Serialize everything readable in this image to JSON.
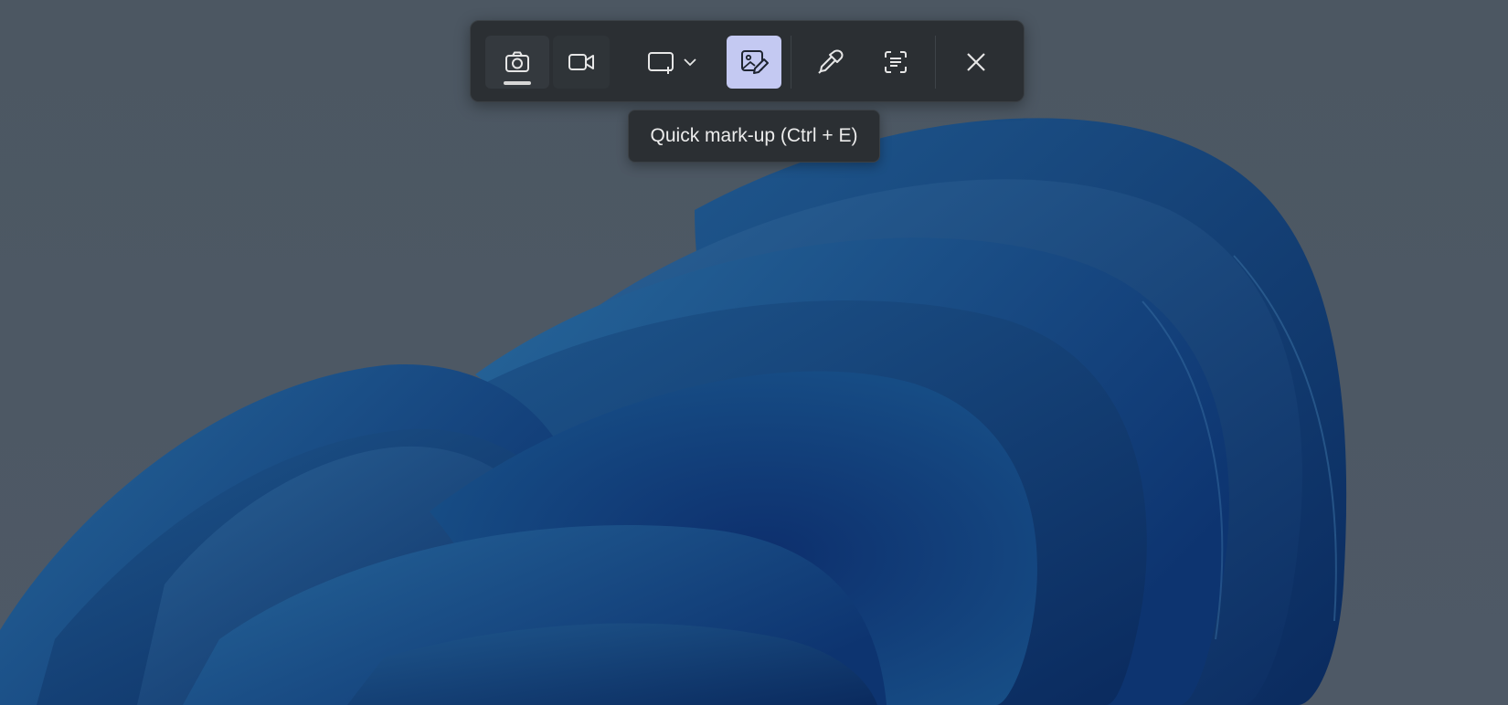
{
  "snipping_toolbar": {
    "buttons": [
      {
        "name": "snip-photo-mode",
        "icon": "camera-icon",
        "active": true
      },
      {
        "name": "snip-video-mode",
        "icon": "video-camera-icon",
        "active": false
      },
      {
        "name": "snip-area-mode-dropdown",
        "icon": "rectangle-area-icon",
        "dropdown_icon": "chevron-down-icon"
      },
      {
        "name": "quick-markup",
        "icon": "image-pen-icon",
        "highlighted": true
      },
      {
        "name": "color-picker",
        "icon": "eyedropper-icon"
      },
      {
        "name": "text-extractor",
        "icon": "text-scan-icon"
      },
      {
        "name": "close",
        "icon": "close-icon"
      }
    ]
  },
  "tooltip": {
    "text": "Quick mark-up (Ctrl + E)"
  },
  "colors": {
    "toolbar_bg": "#2b2f33",
    "highlight": "#c4c9f2",
    "icon": "#e6e6e6",
    "wallpaper_bg": "#4a5560",
    "bloom_blue": "#0f3f7a"
  }
}
